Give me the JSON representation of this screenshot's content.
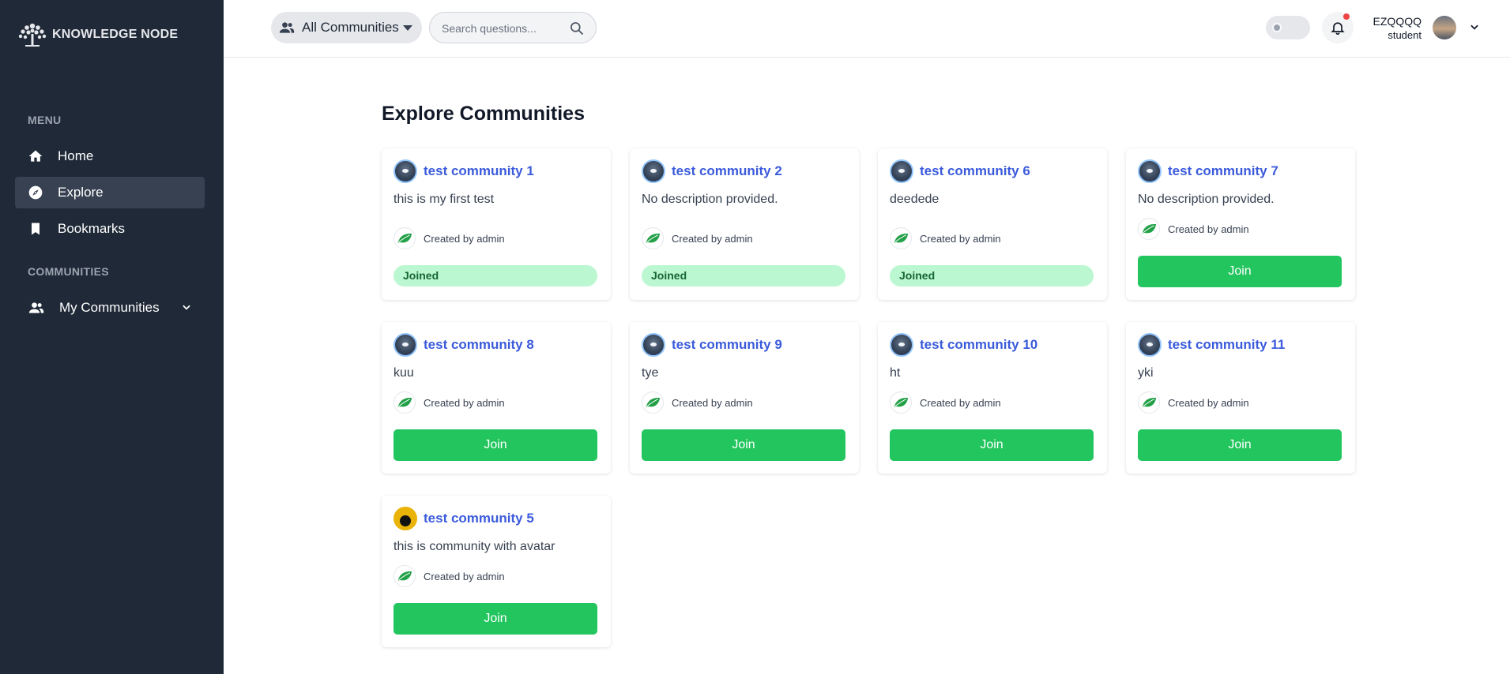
{
  "sidebar": {
    "logo_text": "KNOWLEDGE NODE",
    "menu_label": "MENU",
    "items": [
      {
        "label": "Home",
        "icon": "home-icon"
      },
      {
        "label": "Explore",
        "icon": "compass-icon",
        "active": true
      },
      {
        "label": "Bookmarks",
        "icon": "bookmark-icon"
      }
    ],
    "communities_label": "COMMUNITIES",
    "my_communities_label": "My Communities"
  },
  "header": {
    "community_select": "All Communities",
    "search_placeholder": "Search questions...",
    "user_name": "EZQQQQ",
    "user_role": "student"
  },
  "main": {
    "title": "Explore Communities",
    "cards": [
      {
        "name": "test community 1",
        "description": "this is my first test",
        "creator": "Created by admin",
        "status": "Joined"
      },
      {
        "name": "test community 2",
        "description": "No description provided.",
        "creator": "Created by admin",
        "status": "Joined"
      },
      {
        "name": "test community 6",
        "description": "deedede",
        "creator": "Created by admin",
        "status": "Joined"
      },
      {
        "name": "test community 7",
        "description": "No description provided.",
        "creator": "Created by admin",
        "status": "Join"
      },
      {
        "name": "test community 8",
        "description": "kuu",
        "creator": "Created by admin",
        "status": "Join"
      },
      {
        "name": "test community 9",
        "description": "tye",
        "creator": "Created by admin",
        "status": "Join"
      },
      {
        "name": "test community 10",
        "description": "ht",
        "creator": "Created by admin",
        "status": "Join"
      },
      {
        "name": "test community 11",
        "description": "yki",
        "creator": "Created by admin",
        "status": "Join"
      },
      {
        "name": "test community 5",
        "description": "this is community with avatar",
        "creator": "Created by admin",
        "status": "Join"
      }
    ]
  },
  "colors": {
    "sidebar_bg": "#1f2937",
    "accent_link": "#3b5bdb",
    "join_green": "#22c55e",
    "joined_bg": "#bbf7d0"
  }
}
